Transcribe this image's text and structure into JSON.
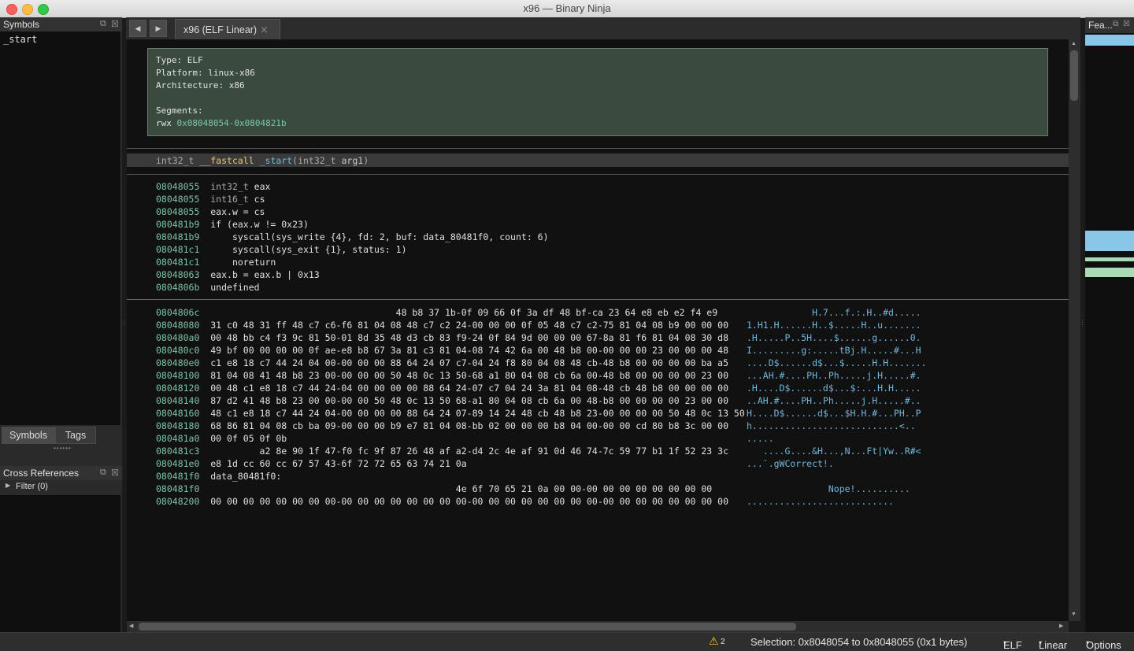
{
  "window": {
    "title": "x96 — Binary Ninja"
  },
  "left_panel": {
    "symbols_title": "Symbols",
    "symbols": [
      "_start"
    ],
    "tabs": [
      "Symbols",
      "Tags"
    ],
    "xrefs_title": "Cross References",
    "filter_label": "Filter (0)"
  },
  "right_panel": {
    "title": "Fea..."
  },
  "tab": {
    "label": "x96 (ELF Linear)",
    "close": "⨯"
  },
  "info": {
    "type_label": "Type:",
    "type_value": "ELF",
    "platform_label": "Platform:",
    "platform_value": "linux-x86",
    "arch_label": "Architecture:",
    "arch_value": "x86",
    "segments_label": "Segments:",
    "segment_perm": "rwx",
    "segment_range": "0x08048054-0x0804821b"
  },
  "function_header": {
    "ret_type": "int32_t",
    "callconv": "__fastcall",
    "name": "_start",
    "paren_open": "(",
    "arg_type": "int32_t",
    "arg_name": "arg1",
    "paren_close": ")"
  },
  "code_lines": [
    {
      "addr": "08048055",
      "t1": "int32_t",
      "t2": " eax"
    },
    {
      "addr": "08048055",
      "t1": "int16_t",
      "t2": " cs"
    },
    {
      "addr": "08048055",
      "t1": "",
      "t2": "eax.w = cs"
    },
    {
      "addr": "080481b9",
      "t1": "",
      "t2": "if (eax.w != 0x23)"
    },
    {
      "addr": "080481b9",
      "t1": "",
      "t2": "    syscall(sys_write {4}, fd: 2, buf: data_80481f0, count: 6)"
    },
    {
      "addr": "080481c1",
      "t1": "",
      "t2": "    syscall(sys_exit {1}, status: 1)"
    },
    {
      "addr": "080481c1",
      "t1": "",
      "t2": "    noreturn"
    },
    {
      "addr": "08048063",
      "t1": "",
      "t2": "eax.b = eax.b | 0x13"
    },
    {
      "addr": "0804806b",
      "t1": "",
      "t2": "undefined"
    }
  ],
  "hex_lines": [
    {
      "addr": "0804806c",
      "bytes": "                                  48 b8 37 1b-0f 09 66 0f 3a df 48 bf-ca 23 64 e8 eb e2 f4 e9",
      "ascii": "            H.7...f.:.H..#d....."
    },
    {
      "addr": "08048080",
      "bytes": "31 c0 48 31 ff 48 c7 c6-f6 81 04 08 48 c7 c2 24-00 00 00 0f 05 48 c7 c2-75 81 04 08 b9 00 00 00",
      "ascii": "1.H1.H......H..$.....H..u......."
    },
    {
      "addr": "080480a0",
      "bytes": "00 48 bb c4 f3 9c 81 50-01 8d 35 48 d3 cb 83 f9-24 0f 84 9d 00 00 00 67-8a 81 f6 81 04 08 30 d8",
      "ascii": ".H.....P..5H....$......g......0."
    },
    {
      "addr": "080480c0",
      "bytes": "49 bf 00 00 00 00 0f ae-e8 b8 67 3a 81 c3 81 04-08 74 42 6a 00 48 b8 00-00 00 00 23 00 00 00 48",
      "ascii": "I.........g:.....tBj.H.....#...H"
    },
    {
      "addr": "080480e0",
      "bytes": "c1 e8 18 c7 44 24 04 00-00 00 00 88 64 24 07 c7-04 24 f8 80 04 08 48 cb-48 b8 00 00 00 00 ba a5",
      "ascii": "....D$......d$...$.....H.H......."
    },
    {
      "addr": "08048100",
      "bytes": "81 04 08 41 48 b8 23 00-00 00 00 50 48 0c 13 50-68 a1 80 04 08 cb 6a 00-48 b8 00 00 00 00 23 00",
      "ascii": "...AH.#....PH..Ph.....j.H.....#."
    },
    {
      "addr": "08048120",
      "bytes": "00 48 c1 e8 18 c7 44 24-04 00 00 00 00 88 64 24-07 c7 04 24 3a 81 04 08-48 cb 48 b8 00 00 00 00",
      "ascii": ".H....D$......d$...$:...H.H....."
    },
    {
      "addr": "08048140",
      "bytes": "87 d2 41 48 b8 23 00 00-00 00 50 48 0c 13 50 68-a1 80 04 08 cb 6a 00 48-b8 00 00 00 00 23 00 00",
      "ascii": "..AH.#....PH..Ph.....j.H.....#.."
    },
    {
      "addr": "08048160",
      "bytes": "48 c1 e8 18 c7 44 24 04-00 00 00 00 88 64 24 07-89 14 24 48 cb 48 b8 23-00 00 00 00 50 48 0c 13 50",
      "ascii": "H....D$......d$...$H.H.#...PH..P"
    },
    {
      "addr": "08048180",
      "bytes": "68 86 81 04 08 cb ba 09-00 00 00 b9 e7 81 04 08-bb 02 00 00 00 b8 04 00-00 00 cd 80 b8 3c 00 00",
      "ascii": "h...........................<.."
    },
    {
      "addr": "080481a0",
      "bytes": "00 0f 05 0f 0b",
      "ascii": "....."
    },
    {
      "addr": "080481c3",
      "bytes": "         a2 8e 90 1f 47-f0 fc 9f 87 26 48 af a2-d4 2c 4e af 91 0d 46 74-7c 59 77 b1 1f 52 23 3c",
      "ascii": "   ....G....&H...,N...Ft|Yw..R#<"
    },
    {
      "addr": "080481e0",
      "bytes": "e8 1d cc 60 cc 67 57 43-6f 72 72 65 63 74 21 0a",
      "ascii": "...`.gWCorrect!."
    },
    {
      "addr": "080481f0",
      "bytes": "data_80481f0:",
      "ascii": ""
    },
    {
      "addr": "080481f0",
      "bytes": "                                             4e 6f 70 65 21 0a 00 00-00 00 00 00 00 00 00 00",
      "ascii": "               Nope!.........."
    },
    {
      "addr": "08048200",
      "bytes": "00 00 00 00 00 00 00 00-00 00 00 00 00 00 00 00-00 00 00 00 00 00 00 00-00 00 00 00 00 00 00 00",
      "ascii": "..........................."
    }
  ],
  "status": {
    "warning_count": "2",
    "selection": "Selection: 0x8048054 to 0x8048055 (0x1 bytes)",
    "format": "ELF",
    "view_mode": "Linear",
    "options": "Options"
  },
  "colors": {
    "background": "#111111",
    "address": "#7fc2a5",
    "number": "#6fb7dc",
    "info_box": "#3a4a3f"
  }
}
